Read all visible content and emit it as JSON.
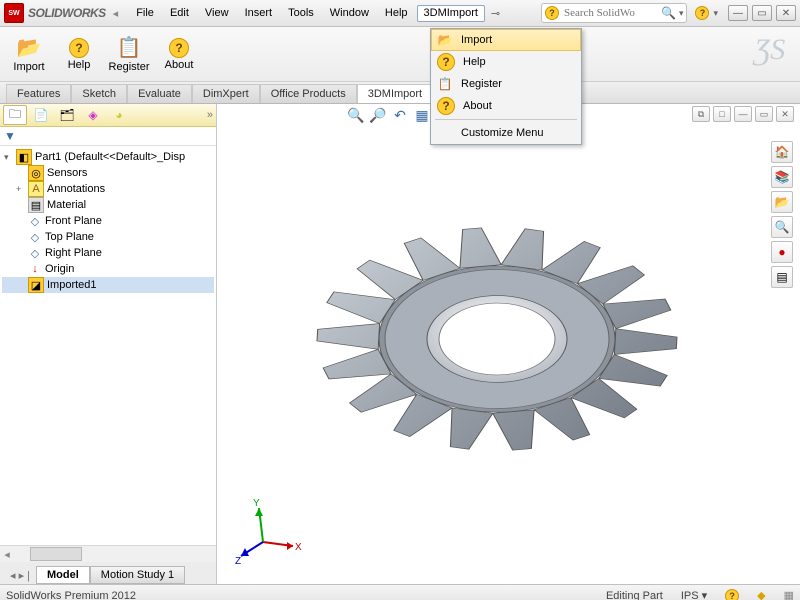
{
  "title": "SOLIDWORKS",
  "menubar": [
    "File",
    "Edit",
    "View",
    "Insert",
    "Tools",
    "Window",
    "Help",
    "3DMImport"
  ],
  "search": {
    "placeholder": "Search SolidWo"
  },
  "toolbar": [
    {
      "label": "Import",
      "icon": "📂"
    },
    {
      "label": "Help",
      "icon": "?"
    },
    {
      "label": "Register",
      "icon": "📋"
    },
    {
      "label": "About",
      "icon": "?"
    }
  ],
  "cmdtabs": [
    "Features",
    "Sketch",
    "Evaluate",
    "DimXpert",
    "Office Products",
    "3DMImport"
  ],
  "tree": {
    "root": "Part1  (Default<<Default>_Disp",
    "nodes": [
      {
        "label": "Sensors",
        "icon": "sensor"
      },
      {
        "label": "Annotations",
        "icon": "ann",
        "expand": "+"
      },
      {
        "label": "Material <not specified>",
        "icon": "mat"
      },
      {
        "label": "Front Plane",
        "icon": "plane"
      },
      {
        "label": "Top Plane",
        "icon": "plane"
      },
      {
        "label": "Right Plane",
        "icon": "plane"
      },
      {
        "label": "Origin",
        "icon": "origin"
      },
      {
        "label": "Imported1",
        "icon": "imp",
        "sel": true
      }
    ]
  },
  "bottomtabs": [
    "Model",
    "Motion Study 1"
  ],
  "dropdown": {
    "items": [
      "Import",
      "Help",
      "Register",
      "About"
    ],
    "footer": "Customize Menu"
  },
  "status": {
    "left": "SolidWorks Premium 2012",
    "mode": "Editing Part",
    "units": "IPS"
  },
  "triad": {
    "x": "X",
    "y": "Y",
    "z": "Z"
  }
}
